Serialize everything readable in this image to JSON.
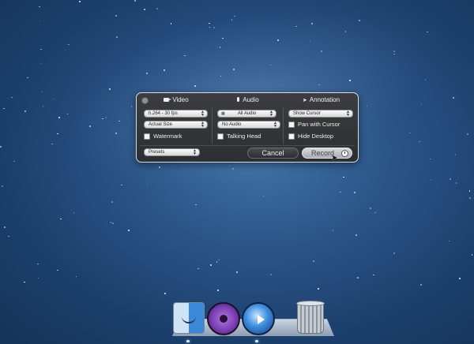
{
  "video": {
    "title": "Video",
    "format_select": "h.264 - 30 fps",
    "size_select": "Actual Size",
    "watermark_label": "Watermark",
    "presets_select": "Presets"
  },
  "audio": {
    "title": "Audio",
    "source_select": "All Audio",
    "second_select": "No Audio",
    "talking_head_label": "Talking Head"
  },
  "annotation": {
    "title": "Annotation",
    "cursor_select": "Show Cursor",
    "pan_label": "Pan with Cursor",
    "hide_desktop_label": "Hide Desktop"
  },
  "actions": {
    "cancel_label": "Cancel",
    "record_label": "Record"
  },
  "dock": {
    "icons": [
      "finder-icon",
      "aperture-icon",
      "quicktime-icon",
      "trash-icon"
    ]
  },
  "colors": {
    "panel_bg": "#333538",
    "desktop_blue": "#2a5587",
    "record_button": "#c3c6ca"
  }
}
